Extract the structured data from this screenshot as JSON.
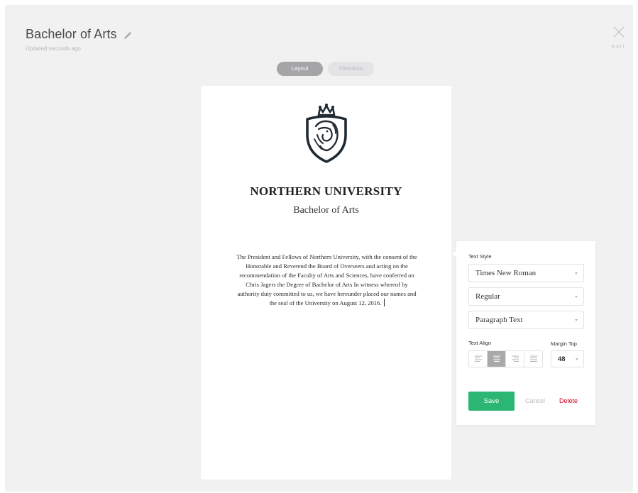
{
  "header": {
    "title": "Bachelor of Arts",
    "updated": "Updated seconds ago",
    "exit_label": "EXIT"
  },
  "tabs": [
    {
      "label": "Layout",
      "active": true
    },
    {
      "label": "Metadata",
      "active": false
    }
  ],
  "document": {
    "university": "NORTHERN UNIVERSITY",
    "degree": "Bachelor of Arts",
    "body_lines": [
      "The President and Fellows of Northern University, with the consent of the",
      "Honorable and Reverend the Board of Overseers and acting on the",
      "recommendation of the Faculty of Arts and Sciences, have conferred on",
      "Chris Jagers the Degree of Bachelor of Arts In witness whereof by",
      "authority duty committed to us, we have hereunder placed our names and",
      "the seal of the University on August 12, 2016."
    ],
    "logo_icon": "lion-crest-icon"
  },
  "panel": {
    "text_style_label": "Text Style",
    "font_family": "Times New Roman",
    "font_weight": "Regular",
    "text_type": "Paragraph Text",
    "text_align_label": "Text Align",
    "text_align_options": [
      "left",
      "center",
      "right",
      "justify"
    ],
    "text_align_selected": "center",
    "margin_top_label": "Margin Top",
    "margin_top": "48",
    "save_label": "Save",
    "cancel_label": "Cancel",
    "delete_label": "Delete"
  },
  "colors": {
    "background": "#f1f1f2",
    "save": "#2bb673",
    "delete": "#d0021b",
    "active_tab": "#a5a5a8"
  }
}
